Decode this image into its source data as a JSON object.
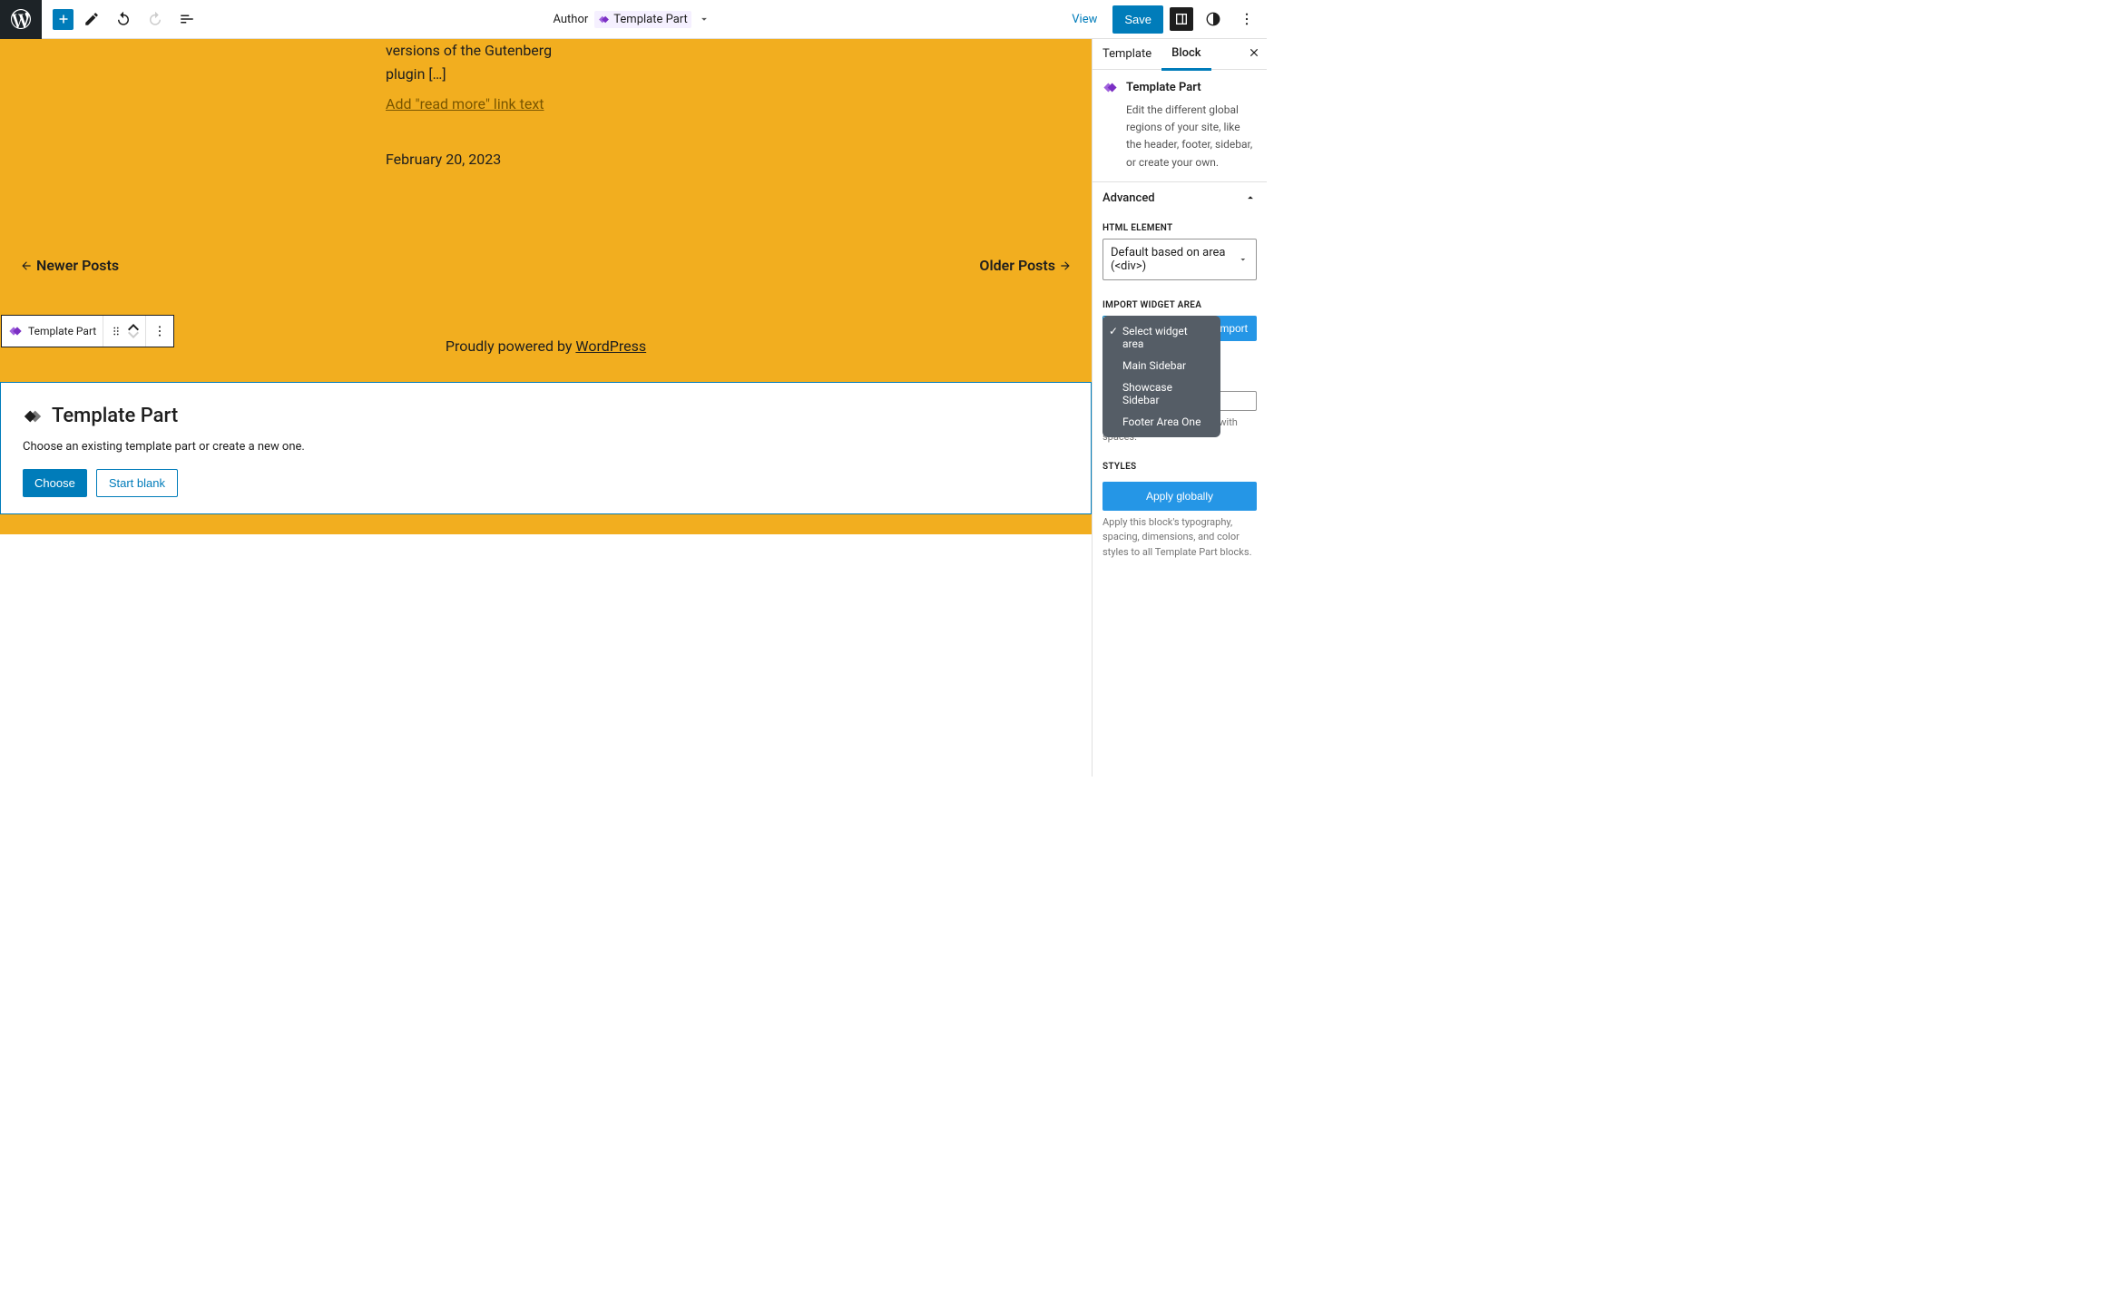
{
  "toolbar": {
    "author_label": "Author",
    "template_part_label": "Template Part",
    "view": "View",
    "save": "Save"
  },
  "canvas": {
    "excerpt": "versions of the Gutenberg plugin […]",
    "read_more": "Add \"read more\" link text",
    "post_date": "February 20, 2023",
    "newer": "Newer Posts",
    "older": "Older Posts",
    "credit_prefix": "Proudly powered by ",
    "credit_link": "WordPress"
  },
  "block_toolbar": {
    "label": "Template Part"
  },
  "placeholder": {
    "title": "Template Part",
    "desc": "Choose an existing template part or create a new one.",
    "choose": "Choose",
    "start_blank": "Start blank"
  },
  "sidebar": {
    "tabs": {
      "template": "Template",
      "block": "Block"
    },
    "card": {
      "title": "Template Part",
      "desc": "Edit the different global regions of your site, like the header, footer, sidebar, or create your own."
    },
    "advanced": {
      "title": "Advanced",
      "html_element_label": "HTML ELEMENT",
      "html_element_value": "Default based on area (<div>)",
      "import_label": "IMPORT WIDGET AREA",
      "import_btn": "Import",
      "dropdown": {
        "opt0": "Select widget area",
        "opt1": "Main Sidebar",
        "opt2": "Showcase Sidebar",
        "opt3": "Footer Area One"
      },
      "css_help": "Separate multiple classes with spaces.",
      "styles_label": "STYLES",
      "apply": "Apply globally",
      "apply_help": "Apply this block's typography, spacing, dimensions, and color styles to all Template Part blocks."
    }
  }
}
